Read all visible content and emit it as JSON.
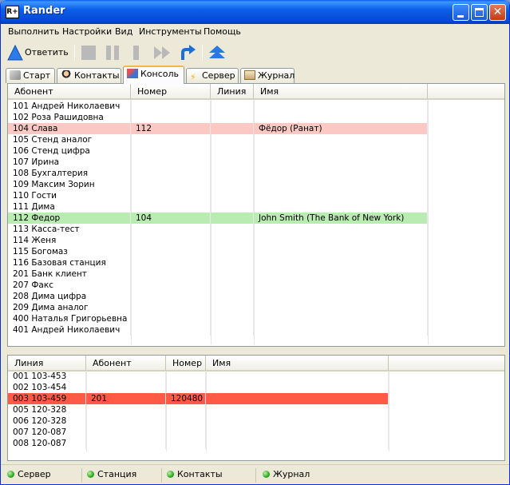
{
  "window": {
    "title": "Rander",
    "icon_text": "R+"
  },
  "menu": [
    "Выполнить",
    "Настройки",
    "Вид",
    "Инструменты",
    "Помощь"
  ],
  "toolbar": {
    "answer_label": "Ответить"
  },
  "tabs": [
    {
      "label": "Старт",
      "icon": "start-icon"
    },
    {
      "label": "Контакты",
      "icon": "contacts-icon"
    },
    {
      "label": "Консоль",
      "icon": "console-icon",
      "active": true
    },
    {
      "label": "Сервер",
      "icon": "lightning-icon"
    },
    {
      "label": "Журнал",
      "icon": "journal-icon"
    }
  ],
  "subscribers_table": {
    "columns": [
      "Абонент",
      "Номер",
      "Линия",
      "Имя"
    ],
    "rows": [
      {
        "abonent": "101 Андрей Николаевич",
        "number": "",
        "line": "",
        "name": "",
        "hl": ""
      },
      {
        "abonent": "102 Роза Рашидовна",
        "number": "",
        "line": "",
        "name": "",
        "hl": ""
      },
      {
        "abonent": "104 Слава",
        "number": "112",
        "line": "",
        "name": "Фёдор  (Ранат)",
        "hl": "#fbc8c4"
      },
      {
        "abonent": "105 Стенд аналог",
        "number": "",
        "line": "",
        "name": "",
        "hl": ""
      },
      {
        "abonent": "106 Стенд цифра",
        "number": "",
        "line": "",
        "name": "",
        "hl": ""
      },
      {
        "abonent": "107 Ирина",
        "number": "",
        "line": "",
        "name": "",
        "hl": ""
      },
      {
        "abonent": "108 Бухгалтерия",
        "number": "",
        "line": "",
        "name": "",
        "hl": ""
      },
      {
        "abonent": "109 Максим Зорин",
        "number": "",
        "line": "",
        "name": "",
        "hl": ""
      },
      {
        "abonent": "110 Гости",
        "number": "",
        "line": "",
        "name": "",
        "hl": ""
      },
      {
        "abonent": "111 Дима",
        "number": "",
        "line": "",
        "name": "",
        "hl": ""
      },
      {
        "abonent": "112 Федор",
        "number": "104",
        "line": "",
        "name": "John Smith (The Bank of New York)",
        "hl": "#b8ecb0"
      },
      {
        "abonent": "113 Касса-тест",
        "number": "",
        "line": "",
        "name": "",
        "hl": ""
      },
      {
        "abonent": "114 Женя",
        "number": "",
        "line": "",
        "name": "",
        "hl": ""
      },
      {
        "abonent": "115 Богомаз",
        "number": "",
        "line": "",
        "name": "",
        "hl": ""
      },
      {
        "abonent": "116 Базовая станция",
        "number": "",
        "line": "",
        "name": "",
        "hl": ""
      },
      {
        "abonent": "201 Банк клиент",
        "number": "",
        "line": "",
        "name": "",
        "hl": ""
      },
      {
        "abonent": "207 Факс",
        "number": "",
        "line": "",
        "name": "",
        "hl": ""
      },
      {
        "abonent": "208 Дима цифра",
        "number": "",
        "line": "",
        "name": "",
        "hl": ""
      },
      {
        "abonent": "209 Дима аналог",
        "number": "",
        "line": "",
        "name": "",
        "hl": ""
      },
      {
        "abonent": "400 Наталья Григорьевна",
        "number": "",
        "line": "",
        "name": "",
        "hl": ""
      },
      {
        "abonent": "401 Андрей Николаевич",
        "number": "",
        "line": "",
        "name": "",
        "hl": ""
      }
    ]
  },
  "lines_table": {
    "columns": [
      "Линия",
      "Абонент",
      "Номер",
      "Имя"
    ],
    "rows": [
      {
        "line": "001 103-453",
        "abonent": "",
        "number": "",
        "name": "",
        "hl": ""
      },
      {
        "line": "002 103-454",
        "abonent": "",
        "number": "",
        "name": "",
        "hl": ""
      },
      {
        "line": "003 103-459",
        "abonent": "201",
        "number": "120480",
        "name": "",
        "hl": "#ff5a46"
      },
      {
        "line": "005 120-328",
        "abonent": "",
        "number": "",
        "name": "",
        "hl": ""
      },
      {
        "line": "006 120-328",
        "abonent": "",
        "number": "",
        "name": "",
        "hl": ""
      },
      {
        "line": "007 120-087",
        "abonent": "",
        "number": "",
        "name": "",
        "hl": ""
      },
      {
        "line": "008 120-087",
        "abonent": "",
        "number": "",
        "name": "",
        "hl": ""
      }
    ]
  },
  "statusbar": [
    "Сервер",
    "Станция",
    "Контакты",
    "Журнал"
  ]
}
